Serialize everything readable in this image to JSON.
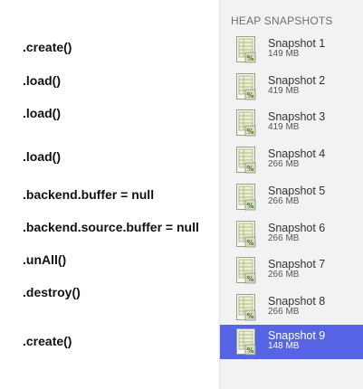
{
  "code_steps": [
    ".create()",
    ".load()",
    ".load()",
    ".load()",
    ".backend.buffer = null",
    ".backend.source.buffer = null",
    ".unAll()",
    ".destroy()",
    ".create()"
  ],
  "heap_panel": {
    "header": "HEAP SNAPSHOTS",
    "selected_index": 8,
    "selected_color": "#5764e6",
    "icon": "snapshot-file-icon",
    "snapshots": [
      {
        "name": "Snapshot 1",
        "size": "149 MB"
      },
      {
        "name": "Snapshot 2",
        "size": "419 MB"
      },
      {
        "name": "Snapshot 3",
        "size": "419 MB"
      },
      {
        "name": "Snapshot 4",
        "size": "266 MB"
      },
      {
        "name": "Snapshot 5",
        "size": "266 MB"
      },
      {
        "name": "Snapshot 6",
        "size": "266 MB"
      },
      {
        "name": "Snapshot 7",
        "size": "266 MB"
      },
      {
        "name": "Snapshot 8",
        "size": "266 MB"
      },
      {
        "name": "Snapshot 9",
        "size": "148 MB"
      }
    ]
  }
}
